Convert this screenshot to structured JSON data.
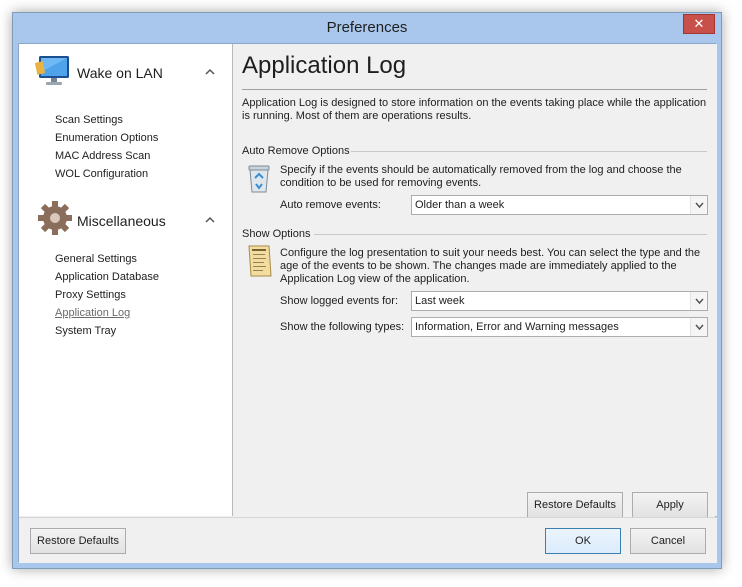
{
  "window": {
    "title": "Preferences",
    "close_glyph": "✕"
  },
  "nav": {
    "groups": [
      {
        "label": "Wake on LAN",
        "icon": "monitor-icon",
        "expanded_glyph": "^",
        "items": [
          "Scan Settings",
          "Enumeration Options",
          "MAC Address Scan",
          "WOL Configuration"
        ]
      },
      {
        "label": "Miscellaneous",
        "icon": "gear-icon",
        "expanded_glyph": "^",
        "items": [
          "General Settings",
          "Application Database",
          "Proxy Settings",
          "Application Log",
          "System Tray"
        ],
        "active_item": "Application Log"
      }
    ]
  },
  "page": {
    "title": "Application Log",
    "description": "Application Log is designed to store information on the events taking place while the application is running. Most of them are operations results.",
    "auto_remove": {
      "section_label": "Auto Remove Options",
      "icon": "recycle-bin-icon",
      "text": "Specify if the events should be automatically removed from the log and choose the condition to be used for removing events.",
      "field_label": "Auto remove events:",
      "value": "Older than a week"
    },
    "show": {
      "section_label": "Show Options",
      "icon": "log-document-icon",
      "text": "Configure the log presentation to suit your needs best. You can select the type and the age of the events to be shown. The changes made are immediately applied to the Application Log view of the application.",
      "events_label": "Show logged events for:",
      "events_value": "Last week",
      "types_label": "Show the following types:",
      "types_value": "Information, Error and Warning messages"
    },
    "restore_defaults_label": "Restore Defaults",
    "apply_label": "Apply"
  },
  "footer": {
    "restore_defaults_label": "Restore Defaults",
    "ok_label": "OK",
    "cancel_label": "Cancel"
  },
  "colors": {
    "titlebar": "#a9c7ec",
    "close_button": "#c7504a",
    "panel": "#f0f0f0"
  }
}
